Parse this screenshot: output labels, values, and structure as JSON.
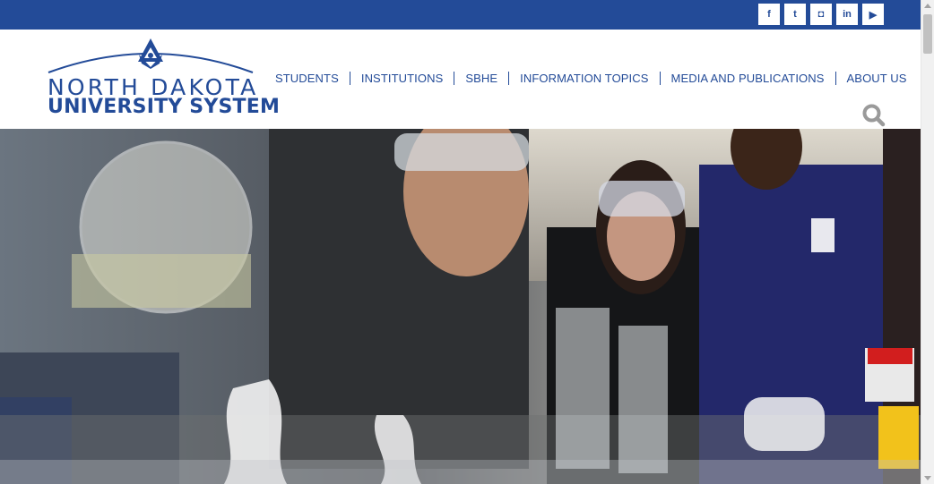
{
  "social": [
    {
      "name": "facebook-icon",
      "glyph": "f"
    },
    {
      "name": "twitter-icon",
      "glyph": "t"
    },
    {
      "name": "instagram-icon",
      "glyph": "◘"
    },
    {
      "name": "linkedin-icon",
      "glyph": "in"
    },
    {
      "name": "youtube-icon",
      "glyph": "▶"
    }
  ],
  "logo": {
    "line1": "NORTH DAKOTA",
    "line2": "UNIVERSITY SYSTEM"
  },
  "nav": [
    {
      "label": "STUDENTS"
    },
    {
      "label": "INSTITUTIONS"
    },
    {
      "label": "SBHE"
    },
    {
      "label": "INFORMATION TOPICS"
    },
    {
      "label": "MEDIA AND PUBLICATIONS"
    },
    {
      "label": "ABOUT US"
    }
  ],
  "colors": {
    "brand": "#234b98",
    "search": "#9a9a9a"
  }
}
